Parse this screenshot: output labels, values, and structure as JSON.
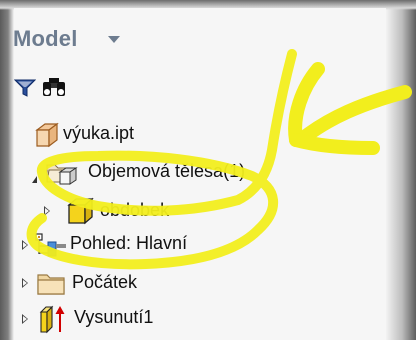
{
  "panel": {
    "title": "Model",
    "toolbar": {
      "filter_icon": "filter-icon",
      "search_icon": "binoculars-icon"
    }
  },
  "tree": {
    "items": [
      {
        "label": "výuka.ipt",
        "icon": "part-icon",
        "expander": "none"
      },
      {
        "label": "Objemová tělesa(1)",
        "icon": "solid-bodies-folder-icon",
        "expander": "expanded"
      },
      {
        "label": "obdobek",
        "icon": "solid-body-icon",
        "expander": "collapsed"
      },
      {
        "label": "Pohled: Hlavní",
        "icon": "view-representation-icon",
        "expander": "collapsed"
      },
      {
        "label": "Počátek",
        "icon": "origin-folder-icon",
        "expander": "collapsed"
      },
      {
        "label": "Vysunutí1",
        "icon": "extrusion-icon",
        "expander": "collapsed"
      }
    ]
  },
  "annotation": {
    "highlight_color": "#f2ee1d",
    "arrow_icon": "arrow-pointer-icon"
  },
  "colors": {
    "title": "#6d7c8f",
    "body_yellow": "#f4d31c",
    "folder_beige": "#f1d7a2",
    "extrude_red": "#d10000"
  }
}
